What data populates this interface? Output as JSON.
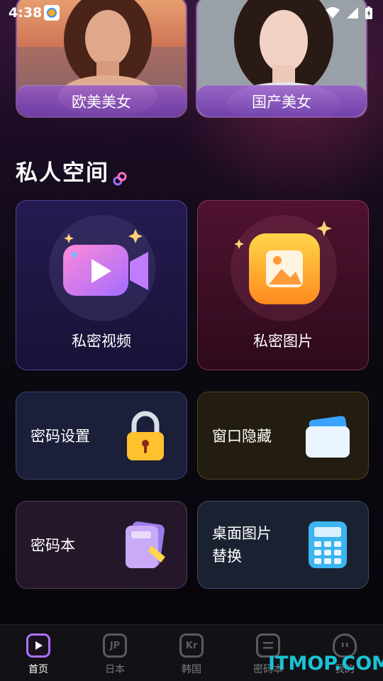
{
  "status": {
    "time": "4:38"
  },
  "top_categories": [
    {
      "label": "欧美美女"
    },
    {
      "label": "国产美女"
    }
  ],
  "section": {
    "title": "私人空间",
    "icon": "link-icon"
  },
  "features": {
    "video": {
      "label": "私密视频",
      "icon": "video-camera-icon"
    },
    "photo": {
      "label": "私密图片",
      "icon": "image-icon"
    },
    "password": {
      "label": "密码设置",
      "icon": "padlock-icon"
    },
    "hide": {
      "label": "窗口隐藏",
      "icon": "card-wallet-icon"
    },
    "notebook": {
      "label": "密码本",
      "icon": "notebook-icon"
    },
    "calculator": {
      "label_line1": "桌面图片",
      "label_line2": "替换",
      "icon": "calculator-icon"
    }
  },
  "nav": [
    {
      "label": "首页",
      "icon": "play-icon",
      "active": true
    },
    {
      "label": "日本",
      "icon": "JP"
    },
    {
      "label": "韩国",
      "icon": "Kr"
    },
    {
      "label": "密码本",
      "icon": "list-icon"
    },
    {
      "label": "我的",
      "icon": "face-icon"
    }
  ],
  "watermark": "ITMOP.COM"
}
